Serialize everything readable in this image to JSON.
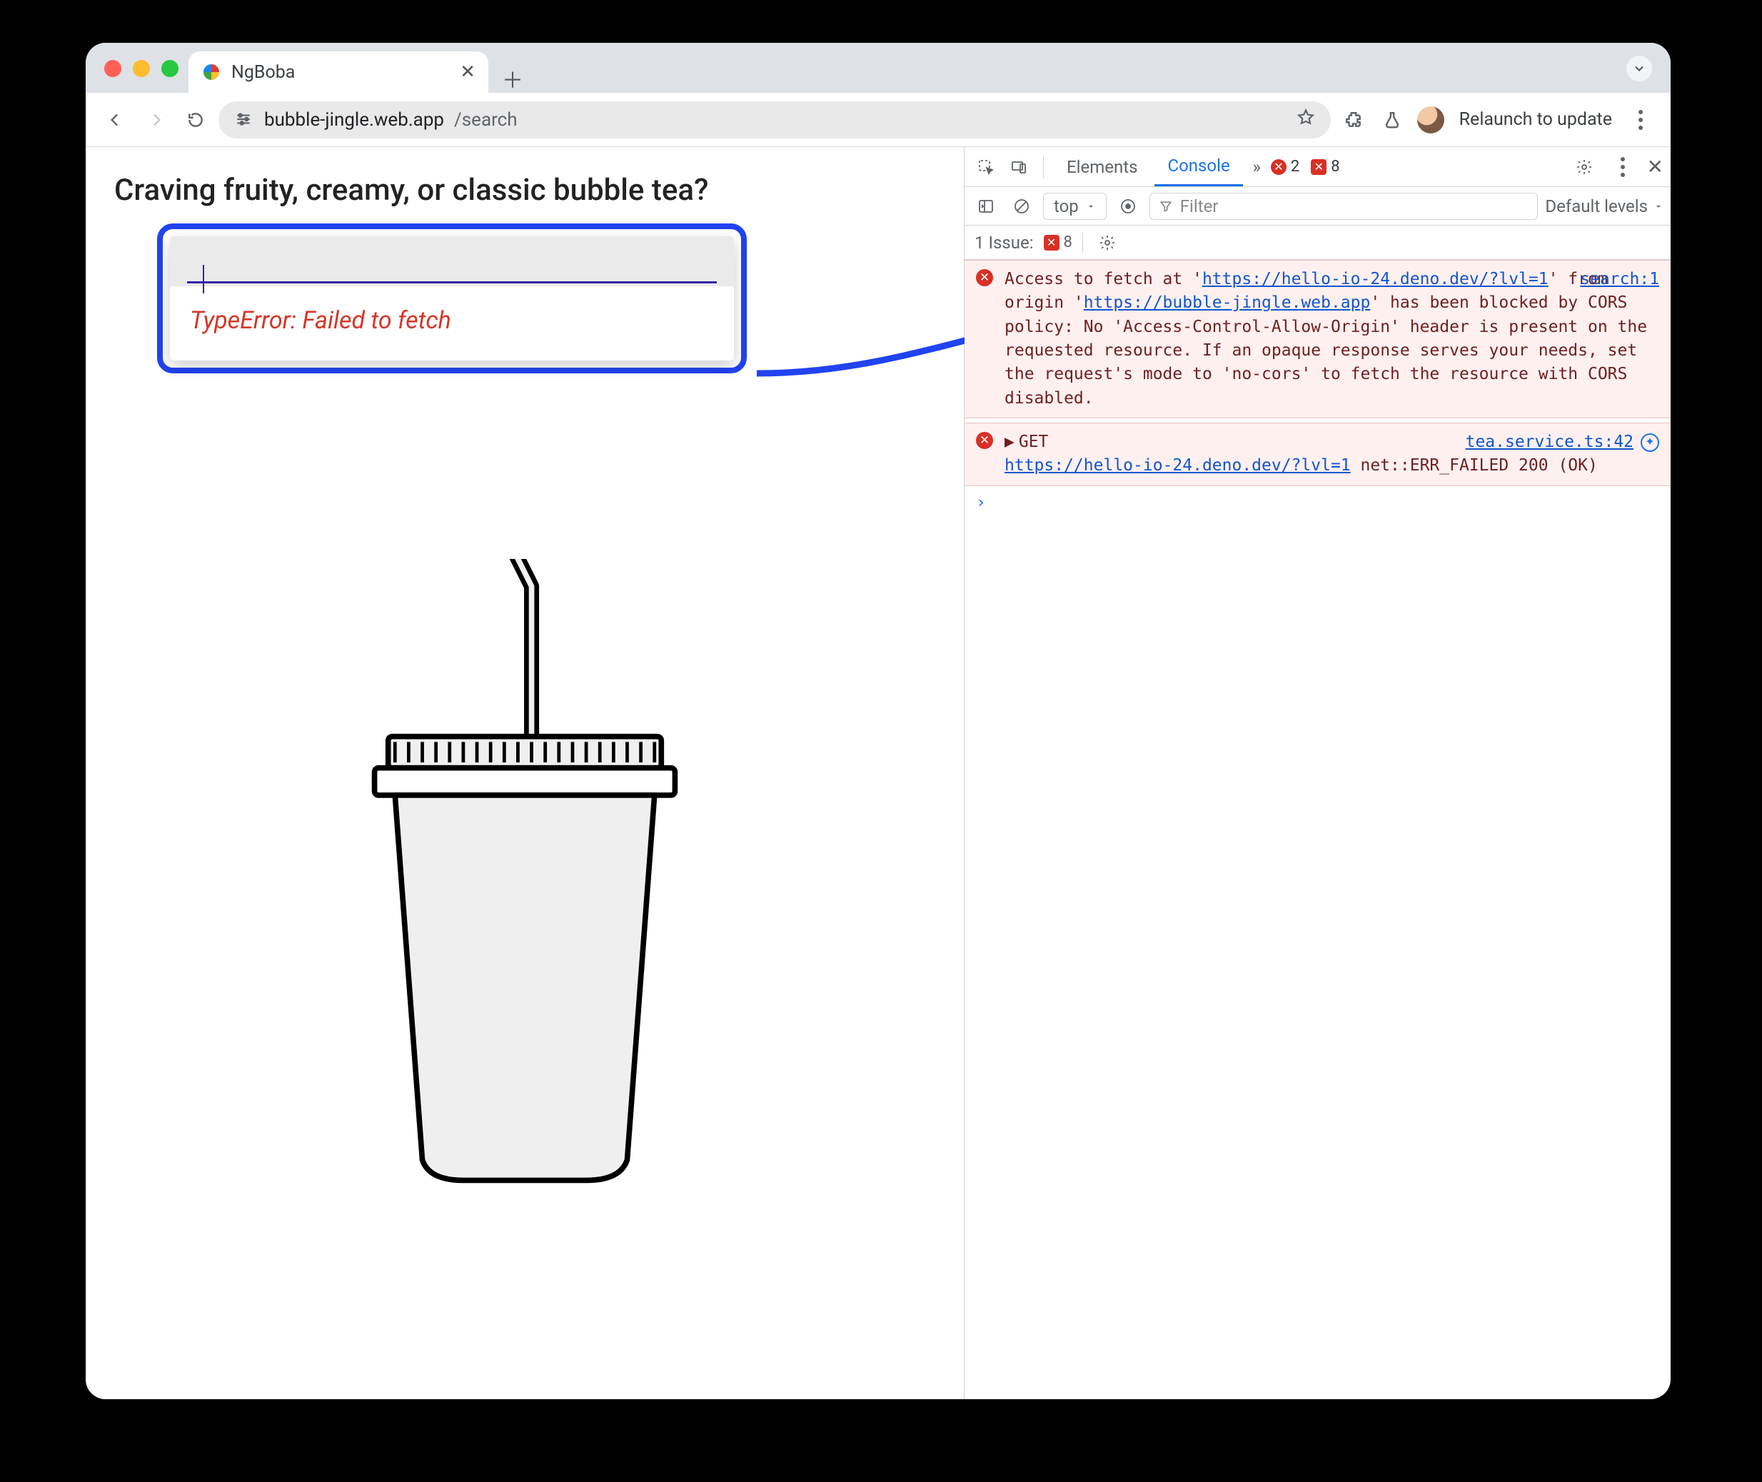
{
  "browser": {
    "tab_title": "NgBoba",
    "address": {
      "domain": "bubble-jingle.web.app",
      "path": "/search"
    },
    "relaunch_label": "Relaunch to update"
  },
  "page": {
    "heading": "Craving fruity, creamy, or classic bubble tea?",
    "search_value": "",
    "error": "TypeError: Failed to fetch"
  },
  "devtools": {
    "tabs": {
      "elements": "Elements",
      "console": "Console"
    },
    "error_count": "2",
    "issue_badge": "8",
    "filter": {
      "context": "top",
      "placeholder": "Filter",
      "levels": "Default levels"
    },
    "issues": {
      "label": "1 Issue:",
      "count": "8"
    },
    "messages": [
      {
        "source": "search:1",
        "pre": "Access to fetch at '",
        "url1": "https://hello-io-24.deno.dev/?lvl=1",
        "mid1": "' from origin '",
        "url2": "https://bubble-jingle.web.app",
        "post": "' has been blocked by CORS policy: No 'Access-Control-Allow-Origin' header is present on the requested resource. If an opaque response serves your needs, set the request's mode to 'no-cors' to fetch the resource with CORS disabled."
      },
      {
        "source": "tea.service.ts:42",
        "method": "GET",
        "url": "https://hello-io-24.deno.dev/?lvl=1",
        "status": " net::ERR_FAILED 200 (OK)"
      }
    ]
  }
}
